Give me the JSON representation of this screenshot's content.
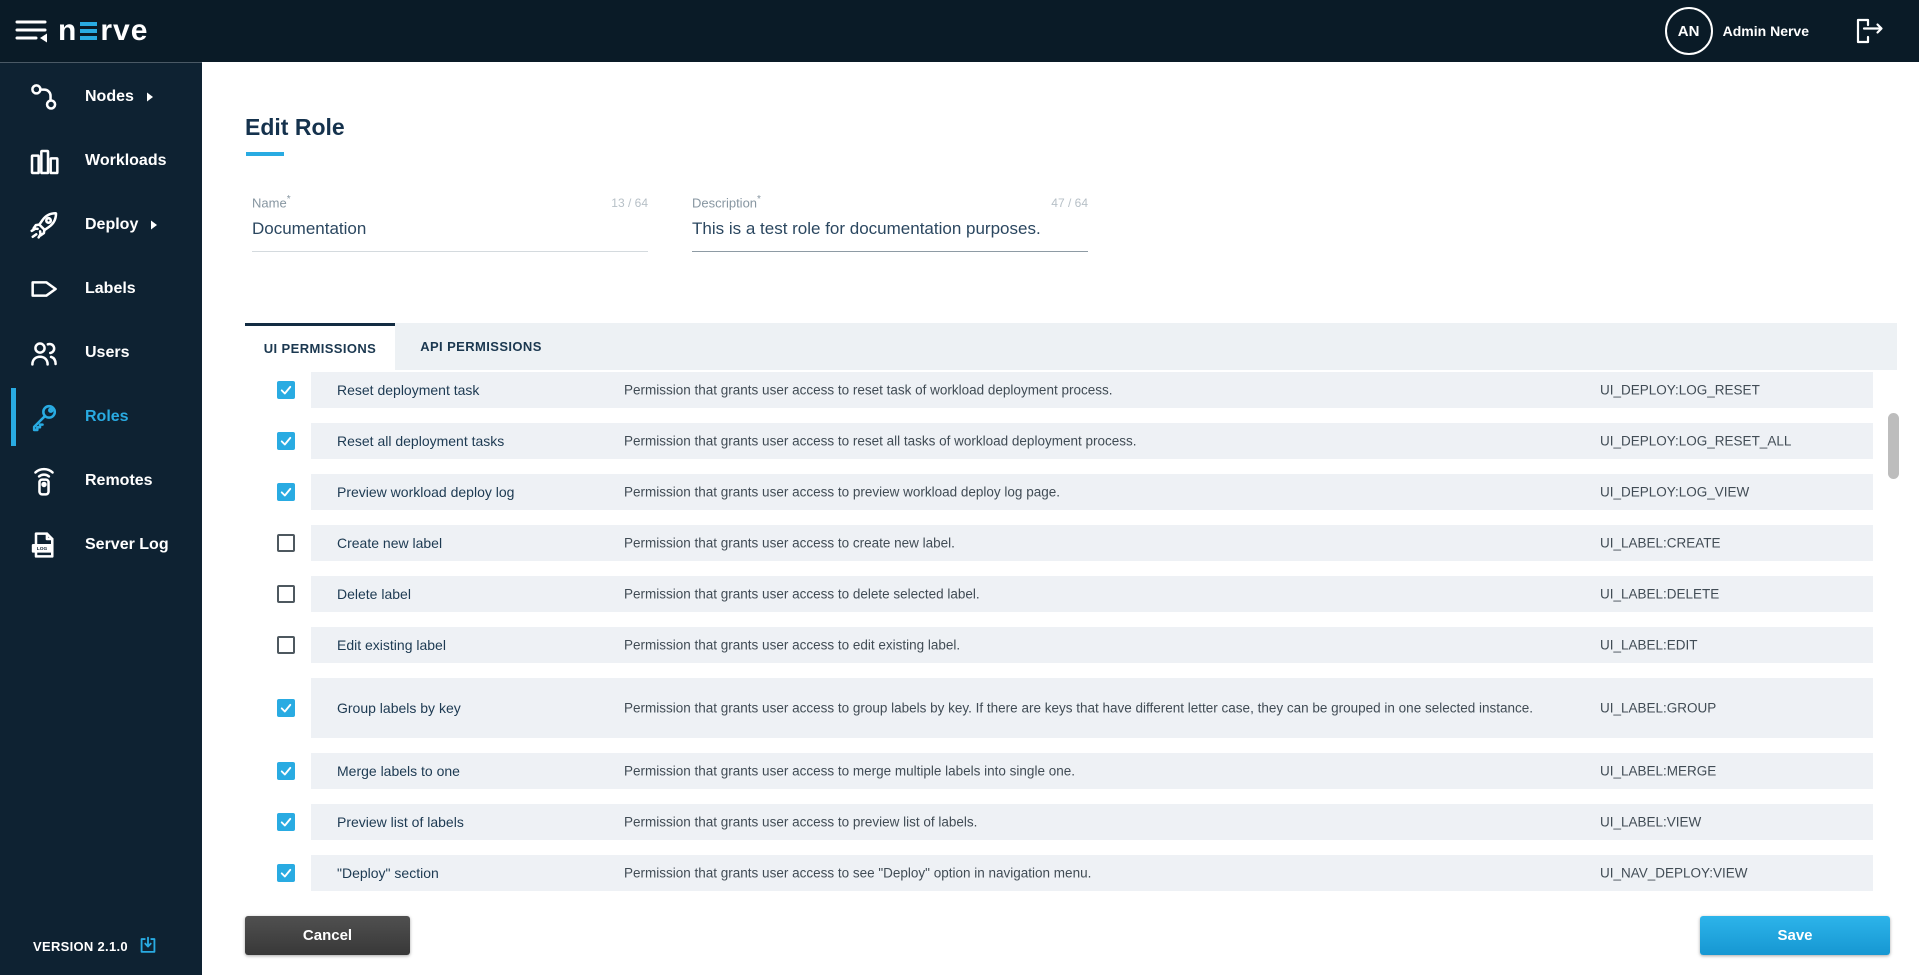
{
  "colors": {
    "accent": "#29abe2",
    "topbar_bg": "#0a1b27",
    "sidebar_bg": "#0e2232",
    "row_bg": "#eef1f5",
    "tab_band_bg": "#edf1f4",
    "title_text": "#15324d"
  },
  "topbar": {
    "logo_prefix": "n",
    "logo_suffix": "rve",
    "user_initials": "AN",
    "user_name": "Admin Nerve",
    "icons": [
      "menu-collapse-icon",
      "logout-icon"
    ]
  },
  "sidebar": {
    "items": [
      {
        "id": "nodes",
        "label": "Nodes",
        "icon": "nodes-icon",
        "has_chevron": true,
        "active": false
      },
      {
        "id": "workloads",
        "label": "Workloads",
        "icon": "workloads-icon",
        "has_chevron": false,
        "active": false
      },
      {
        "id": "deploy",
        "label": "Deploy",
        "icon": "deploy-rocket-icon",
        "has_chevron": true,
        "active": false
      },
      {
        "id": "labels",
        "label": "Labels",
        "icon": "label-tag-icon",
        "has_chevron": false,
        "active": false
      },
      {
        "id": "users",
        "label": "Users",
        "icon": "users-icon",
        "has_chevron": false,
        "active": false
      },
      {
        "id": "roles",
        "label": "Roles",
        "icon": "key-icon",
        "has_chevron": false,
        "active": true
      },
      {
        "id": "remotes",
        "label": "Remotes",
        "icon": "remote-icon",
        "has_chevron": false,
        "active": false
      },
      {
        "id": "server-log",
        "label": "Server Log",
        "icon": "log-file-icon",
        "has_chevron": false,
        "active": false
      }
    ],
    "version_label": "VERSION 2.1.0",
    "version_icon": "download-icon"
  },
  "page": {
    "title": "Edit Role",
    "fields": {
      "name": {
        "label": "Name",
        "required_marker": "*",
        "counter": "13 / 64",
        "value": "Documentation"
      },
      "description": {
        "label": "Description",
        "required_marker": "*",
        "counter": "47 / 64",
        "value": "This is a test role for documentation purposes."
      }
    },
    "tabs": [
      {
        "label": "UI PERMISSIONS",
        "active": true
      },
      {
        "label": "API PERMISSIONS",
        "active": false
      }
    ],
    "permissions": [
      {
        "checked": true,
        "name": "Reset deployment task",
        "description": "Permission that grants user access to reset task of workload deployment process.",
        "code": "UI_DEPLOY:LOG_RESET"
      },
      {
        "checked": true,
        "name": "Reset all deployment tasks",
        "description": "Permission that grants user access to reset all tasks of workload deployment process.",
        "code": "UI_DEPLOY:LOG_RESET_ALL"
      },
      {
        "checked": true,
        "name": "Preview workload deploy log",
        "description": "Permission that grants user access to preview workload deploy log page.",
        "code": "UI_DEPLOY:LOG_VIEW"
      },
      {
        "checked": false,
        "name": "Create new label",
        "description": "Permission that grants user access to create new label.",
        "code": "UI_LABEL:CREATE"
      },
      {
        "checked": false,
        "name": "Delete label",
        "description": "Permission that grants user access to delete selected label.",
        "code": "UI_LABEL:DELETE"
      },
      {
        "checked": false,
        "name": "Edit existing label",
        "description": "Permission that grants user access to edit existing label.",
        "code": "UI_LABEL:EDIT"
      },
      {
        "checked": true,
        "name": "Group labels by key",
        "description": "Permission that grants user access to group labels by key. If there are keys that have different letter case, they can be grouped in one selected instance.",
        "code": "UI_LABEL:GROUP"
      },
      {
        "checked": true,
        "name": "Merge labels to one",
        "description": "Permission that grants user access to merge multiple labels into single one.",
        "code": "UI_LABEL:MERGE"
      },
      {
        "checked": true,
        "name": "Preview list of labels",
        "description": "Permission that grants user access to preview list of labels.",
        "code": "UI_LABEL:VIEW"
      },
      {
        "checked": true,
        "name": "\"Deploy\" section",
        "description": "Permission that grants user access to see \"Deploy\" option in navigation menu.",
        "code": "UI_NAV_DEPLOY:VIEW"
      }
    ],
    "actions": {
      "cancel_label": "Cancel",
      "save_label": "Save"
    }
  }
}
